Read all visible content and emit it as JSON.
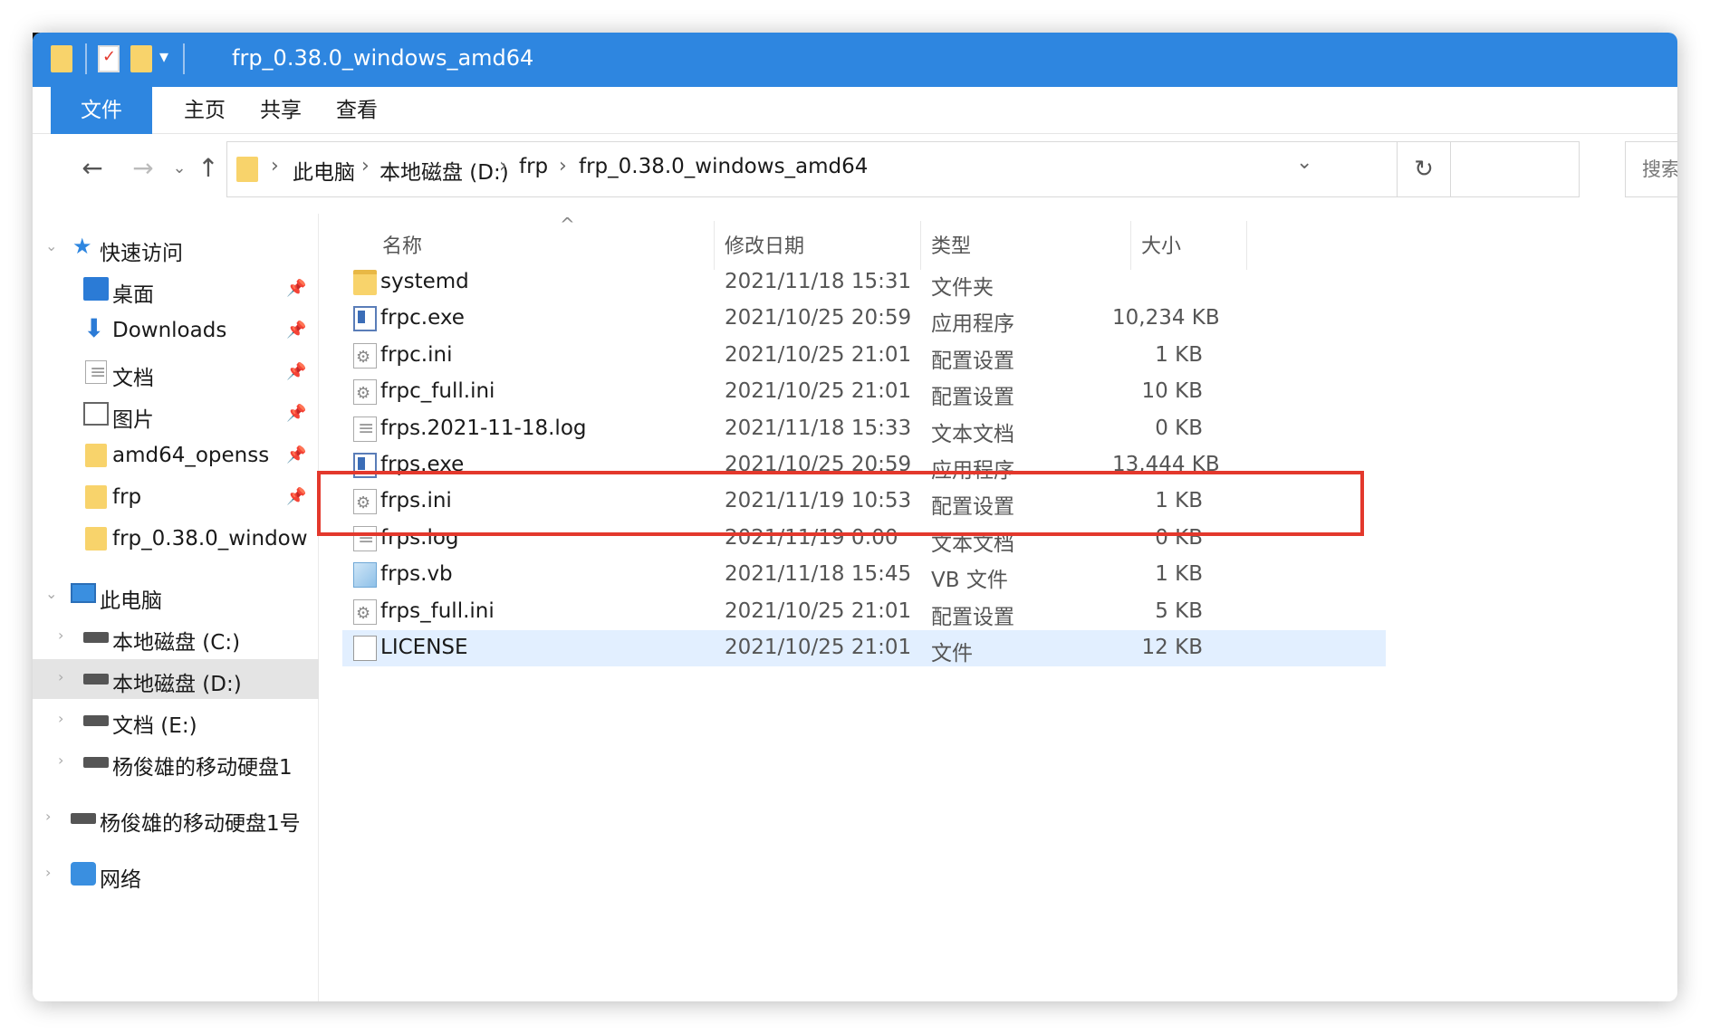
{
  "window": {
    "title": "frp_0.38.0_windows_amd64"
  },
  "ribbon": {
    "tabs": [
      "文件",
      "主页",
      "共享",
      "查看"
    ]
  },
  "address": {
    "crumbs": [
      "此电脑",
      "本地磁盘 (D:)",
      "frp",
      "frp_0.38.0_windows_amd64"
    ],
    "search_placeholder": "搜索"
  },
  "sidebar": {
    "quick_access": "快速访问",
    "quick_items": [
      "桌面",
      "Downloads",
      "文档",
      "图片",
      "amd64_openss",
      "frp",
      "frp_0.38.0_window"
    ],
    "this_pc": "此电脑",
    "drives": [
      "本地磁盘 (C:)",
      "本地磁盘 (D:)",
      "文档 (E:)",
      "杨俊雄的移动硬盘1"
    ],
    "external": "杨俊雄的移动硬盘1号",
    "network": "网络"
  },
  "columns": {
    "name": "名称",
    "date": "修改日期",
    "type": "类型",
    "size": "大小"
  },
  "files": [
    {
      "name": "systemd",
      "date": "2021/11/18 15:31",
      "type": "文件夹",
      "size": "",
      "icon": "folder-icon"
    },
    {
      "name": "frpc.exe",
      "date": "2021/10/25 20:59",
      "type": "应用程序",
      "size": "10,234 KB",
      "icon": "exe-icon"
    },
    {
      "name": "frpc.ini",
      "date": "2021/10/25 21:01",
      "type": "配置设置",
      "size": "1 KB",
      "icon": "ini-icon"
    },
    {
      "name": "frpc_full.ini",
      "date": "2021/10/25 21:01",
      "type": "配置设置",
      "size": "10 KB",
      "icon": "ini-icon"
    },
    {
      "name": "frps.2021-11-18.log",
      "date": "2021/11/18 15:33",
      "type": "文本文档",
      "size": "0 KB",
      "icon": "log-icon"
    },
    {
      "name": "frps.exe",
      "date": "2021/10/25 20:59",
      "type": "应用程序",
      "size": "13,444 KB",
      "icon": "exe-icon"
    },
    {
      "name": "frps.ini",
      "date": "2021/11/19 10:53",
      "type": "配置设置",
      "size": "1 KB",
      "icon": "ini-icon"
    },
    {
      "name": "frps.log",
      "date": "2021/11/19 0:00",
      "type": "文本文档",
      "size": "0 KB",
      "icon": "log-icon"
    },
    {
      "name": "frps.vb",
      "date": "2021/11/18 15:45",
      "type": "VB 文件",
      "size": "1 KB",
      "icon": "vb-file-icon"
    },
    {
      "name": "frps_full.ini",
      "date": "2021/10/25 21:01",
      "type": "配置设置",
      "size": "5 KB",
      "icon": "ini-icon"
    },
    {
      "name": "LICENSE",
      "date": "2021/10/25 21:01",
      "type": "文件",
      "size": "12 KB",
      "icon": "file-icon"
    }
  ],
  "colors": {
    "accent": "#2e86e0",
    "highlight": "#e3382c",
    "selected_row": "#e2efff"
  }
}
